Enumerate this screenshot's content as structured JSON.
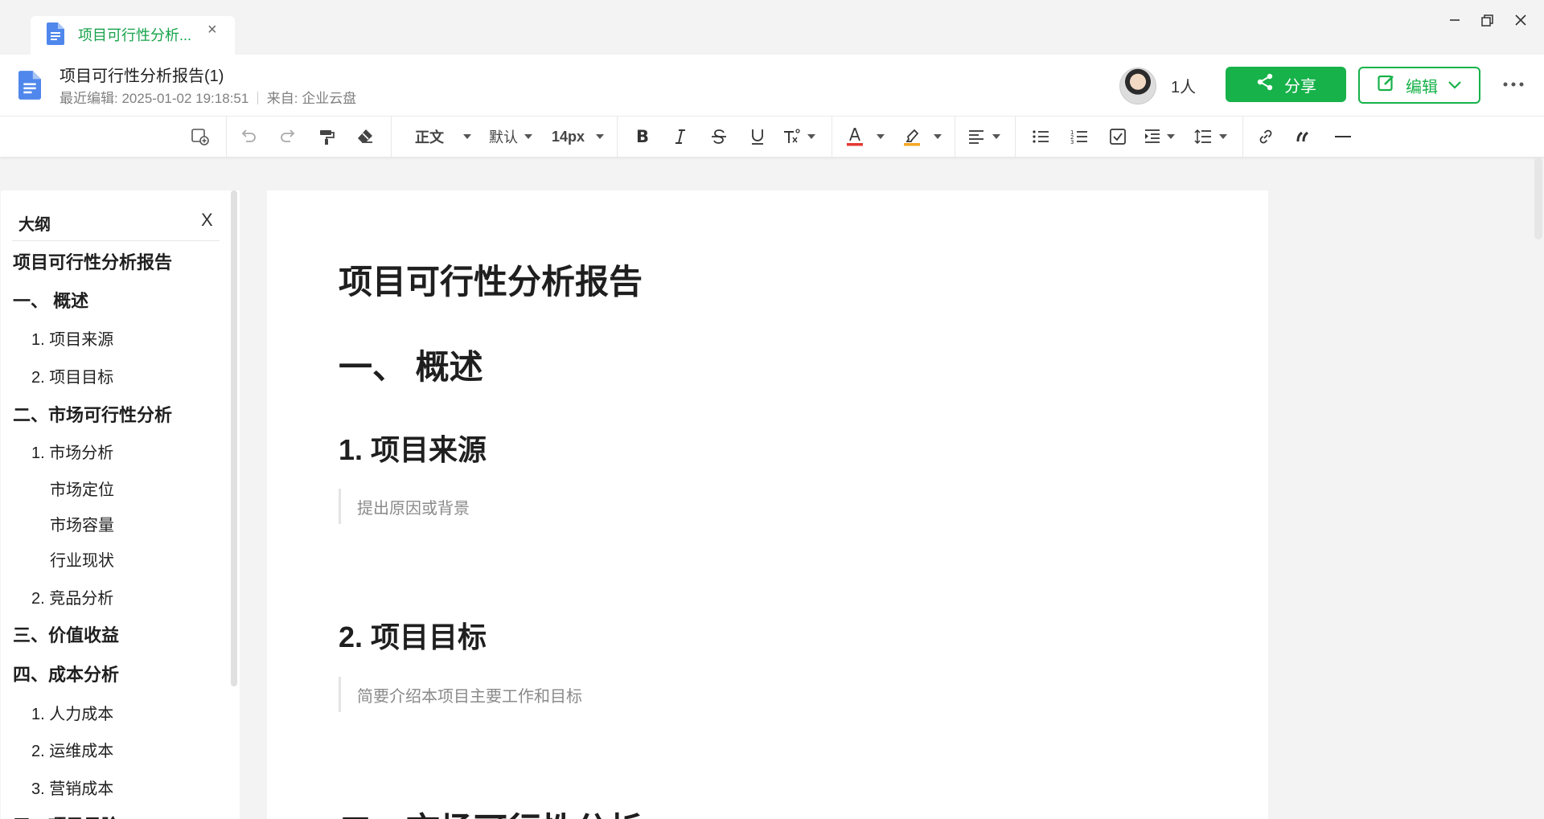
{
  "tab": {
    "title": "项目可行性分析...",
    "close": "×"
  },
  "header": {
    "title": "项目可行性分析报告(1)",
    "last_edit_label": "最近编辑:",
    "last_edit_time": "2025-01-02 19:18:51",
    "source_label": "来自:",
    "source": "企业云盘",
    "collaborators": "1人",
    "share_label": "分享",
    "edit_label": "编辑"
  },
  "toolbar": {
    "paragraph_style": "正文",
    "font": "默认",
    "font_size": "14px",
    "colors": {
      "font_color": "#e53935",
      "highlight_color": "#f5a623"
    }
  },
  "outline": {
    "title": "大纲",
    "close": "X",
    "items": [
      {
        "label": "项目可行性分析报告",
        "level": 0
      },
      {
        "label": "一、 概述",
        "level": 0
      },
      {
        "label": "1. 项目来源",
        "level": 1
      },
      {
        "label": "2. 项目目标",
        "level": 1
      },
      {
        "label": "二、市场可行性分析",
        "level": 0
      },
      {
        "label": "1. 市场分析",
        "level": 1
      },
      {
        "label": "市场定位",
        "level": 2
      },
      {
        "label": "市场容量",
        "level": 2
      },
      {
        "label": "行业现状",
        "level": 2
      },
      {
        "label": "2. 竞品分析",
        "level": 1
      },
      {
        "label": "三、价值收益",
        "level": 0
      },
      {
        "label": "四、成本分析",
        "level": 0
      },
      {
        "label": "1. 人力成本",
        "level": 1
      },
      {
        "label": "2. 运维成本",
        "level": 1
      },
      {
        "label": "3. 营销成本",
        "level": 1
      },
      {
        "label": "五、项目风险",
        "level": 0
      }
    ]
  },
  "document": {
    "title": "项目可行性分析报告",
    "section1": "一、 概述",
    "sub1": "1. 项目来源",
    "sub1_text": "提出原因或背景",
    "sub2": "2. 项目目标",
    "sub2_text": "简要介绍本项目主要工作和目标",
    "section2": "二、市场可行性分析"
  },
  "colors": {
    "accent": "#17b24a",
    "tab_title": "#16a34a"
  }
}
